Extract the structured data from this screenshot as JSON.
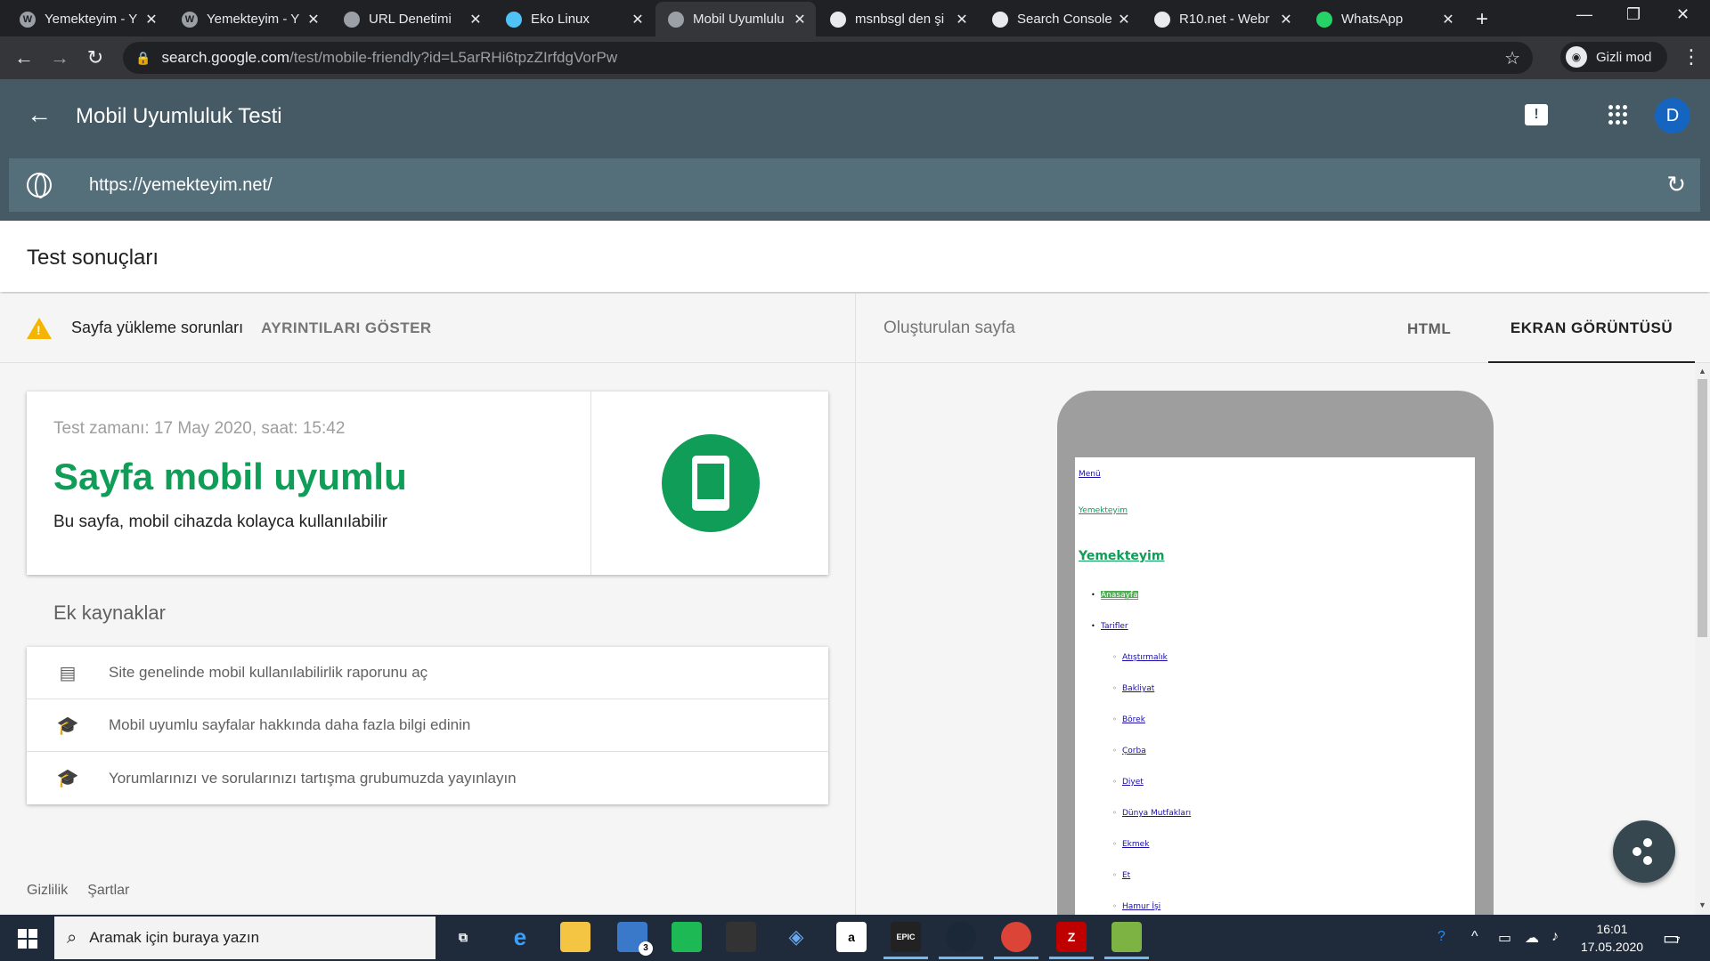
{
  "browser": {
    "tabs": [
      {
        "title": "Yemekteyim - Y",
        "icon": "wordpress-icon"
      },
      {
        "title": "Yemekteyim - Y",
        "icon": "wordpress-icon"
      },
      {
        "title": "URL Denetimi",
        "icon": "search-console-icon"
      },
      {
        "title": "Eko Linux",
        "icon": "cloud-icon"
      },
      {
        "title": "Mobil Uyumlulu",
        "icon": "search-console-icon",
        "active": true
      },
      {
        "title": "msnbsgl den şi",
        "icon": "incognito-icon"
      },
      {
        "title": "Search Console",
        "icon": "incognito-icon"
      },
      {
        "title": "R10.net - Webr",
        "icon": "incognito-icon"
      },
      {
        "title": "WhatsApp",
        "icon": "whatsapp-icon"
      }
    ],
    "url_host": "search.google.com",
    "url_path": "/test/mobile-friendly?id=L5arRHi6tpzZIrfdgVorPw",
    "incognito_label": "Gizli mod"
  },
  "app": {
    "title": "Mobil Uyumluluk Testi",
    "avatar_letter": "D",
    "tested_url": "https://yemekteyim.net/"
  },
  "results": {
    "title": "Test sonuçları",
    "issue_label": "Sayfa yükleme sorunları",
    "details_link": "AYRINTILARI GÖSTER",
    "test_time": "Test zamanı: 17 May 2020, saat: 15:42",
    "verdict": "Sayfa mobil uyumlu",
    "verdict_sub": "Bu sayfa, mobil cihazda kolayca kullanılabilir",
    "resources_title": "Ek kaynaklar",
    "resources": [
      {
        "text": "Site genelinde mobil kullanılabilirlik raporunu aç",
        "icon": "web-icon"
      },
      {
        "text": "Mobil uyumlu sayfalar hakkında daha fazla bilgi edinin",
        "icon": "school-icon"
      },
      {
        "text": "Yorumlarınızı ve sorularınızı tartışma grubumuzda yayınlayın",
        "icon": "school-icon"
      }
    ],
    "footer": {
      "privacy": "Gizlilik",
      "terms": "Şartlar"
    }
  },
  "preview": {
    "label": "Oluşturulan sayfa",
    "tab_html": "HTML",
    "tab_screenshot": "EKRAN GÖRÜNTÜSÜ",
    "menu": "Menü",
    "site_link": "Yemekteyim",
    "site_title": "Yemekteyim",
    "nav": [
      "Anasayfa",
      "Tarifler"
    ],
    "categories": [
      "Atıştırmalık",
      "Bakliyat",
      "Börek",
      "Çorba",
      "Diyet",
      "Dünya Mutfakları",
      "Ekmek",
      "Et",
      "Hamur İşi"
    ]
  },
  "taskbar": {
    "search_placeholder": "Aramak için buraya yazın",
    "mail_badge": "3",
    "time": "16:01",
    "date": "17.05.2020",
    "notification_count": "7"
  }
}
